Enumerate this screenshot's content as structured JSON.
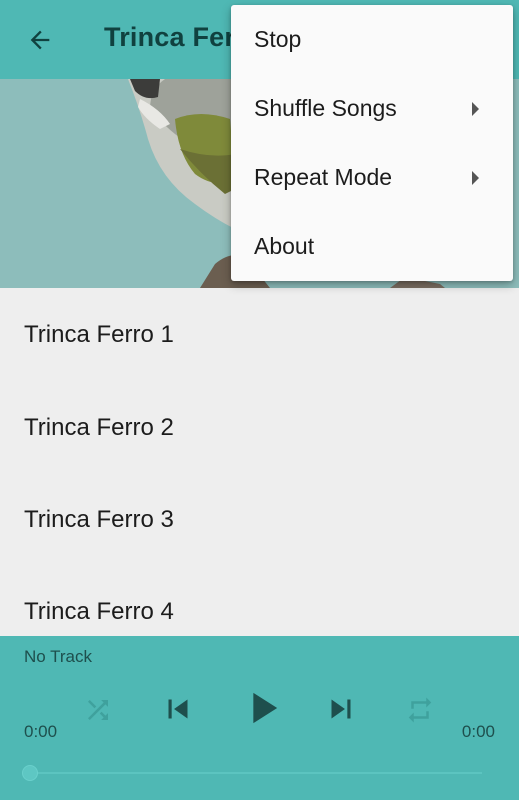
{
  "appbar": {
    "title": "Trinca Ferro"
  },
  "icons": {
    "back": "arrow-back-icon",
    "shuffle": "shuffle-icon",
    "previous": "skip-previous-icon",
    "play": "play-icon",
    "next": "skip-next-icon",
    "repeat": "repeat-icon"
  },
  "colors": {
    "primary": "#4fb8b4",
    "title_text": "#10413f",
    "list_background": "#eeeeee",
    "menu_background": "#fafafa"
  },
  "songs": [
    {
      "label": "Trinca Ferro 1"
    },
    {
      "label": "Trinca Ferro 2"
    },
    {
      "label": "Trinca Ferro 3"
    },
    {
      "label": "Trinca Ferro 4"
    }
  ],
  "player": {
    "track": "No Track",
    "elapsed": "0:00",
    "duration": "0:00",
    "progress": 0
  },
  "menu": {
    "items": [
      {
        "label": "Stop",
        "has_submenu": false
      },
      {
        "label": "Shuffle Songs",
        "has_submenu": true
      },
      {
        "label": "Repeat Mode",
        "has_submenu": true
      },
      {
        "label": "About",
        "has_submenu": false
      }
    ]
  }
}
